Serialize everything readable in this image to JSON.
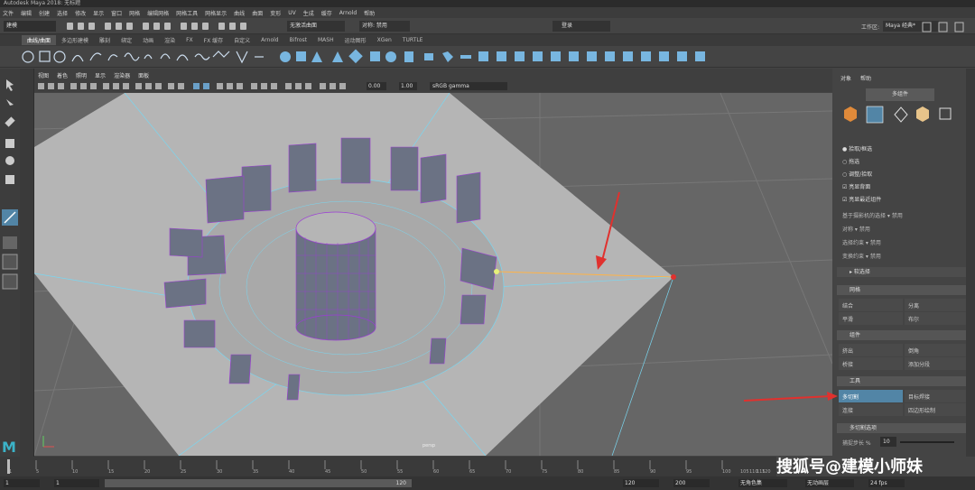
{
  "window": {
    "title": "Autodesk Maya 2018: 无标题"
  },
  "menu": [
    "文件",
    "编辑",
    "创建",
    "选择",
    "修改",
    "显示",
    "窗口",
    "网格",
    "编辑网格",
    "网格工具",
    "网格显示",
    "曲线",
    "曲面",
    "变形",
    "UV",
    "生成",
    "缓存",
    "Arnold",
    "帮助"
  ],
  "status": {
    "mode": "建模",
    "no_live": "无激活曲面",
    "symmetry": "对称: 禁用",
    "login": "登录",
    "workspace_label": "工作区:",
    "workspace_value": "Maya 经典*"
  },
  "shelf_tabs": [
    "曲线/曲面",
    "多边形建模",
    "雕刻",
    "绑定",
    "动画",
    "渲染",
    "FX",
    "FX 缓存",
    "自定义",
    "Arnold",
    "Bifrost",
    "MASH",
    "运动图形",
    "XGen",
    "TURTLE"
  ],
  "active_shelf_tab": 0,
  "viewport_menu": [
    "视图",
    "着色",
    "照明",
    "显示",
    "渲染器",
    "面板"
  ],
  "viewport_fields": {
    "near": "0.00",
    "far": "1.00",
    "colorspace": "sRGB gamma"
  },
  "camera_label": "persp",
  "right_panel": {
    "tabs": [
      "对象",
      "帮助"
    ],
    "component_button": "多组件",
    "options": [
      "拾取/框选",
      "拖选",
      "调整/拾取",
      "亮显背面",
      "亮显最近组件"
    ],
    "symmetry_rows": [
      {
        "label": "基于摄影机的选择",
        "value": "禁用"
      },
      {
        "label": "对称",
        "value": "禁用"
      },
      {
        "label": "选择约束",
        "value": "禁用"
      },
      {
        "label": "变换约束",
        "value": "禁用"
      }
    ],
    "soft_select": "软选择",
    "sections": {
      "mesh": "网格",
      "components": "组件",
      "tools": "工具",
      "multicut": "多切割选项"
    },
    "mesh_buttons": [
      "结合",
      "分离",
      "平滑",
      "布尔"
    ],
    "component_buttons": [
      "挤出",
      "倒角",
      "桥接",
      "添加分段"
    ],
    "tool_buttons": [
      "多切割",
      "目标焊接",
      "连接",
      "四边形绘制"
    ],
    "slice_label": "捕捉步长 %",
    "slice_value": "10"
  },
  "timeline": {
    "ticks": [
      "1",
      "5",
      "10",
      "15",
      "20",
      "25",
      "30",
      "35",
      "40",
      "45",
      "50",
      "55",
      "60",
      "65",
      "70",
      "75",
      "80",
      "85",
      "90",
      "95",
      "100",
      "105",
      "110",
      "115",
      "120"
    ],
    "start": "1",
    "start2": "1",
    "end_inner": "120",
    "end": "120",
    "end2": "200",
    "char_set": "无角色集",
    "anim_layer": "无动画层",
    "fps": "24 fps"
  },
  "watermark": "搜狐号@建模小师妹",
  "colors": {
    "highlight": "#5285a6",
    "arrow": "#e0312e",
    "mesh_edge": "#7ad6f0",
    "mesh_vertex": "#9c3cd6"
  }
}
